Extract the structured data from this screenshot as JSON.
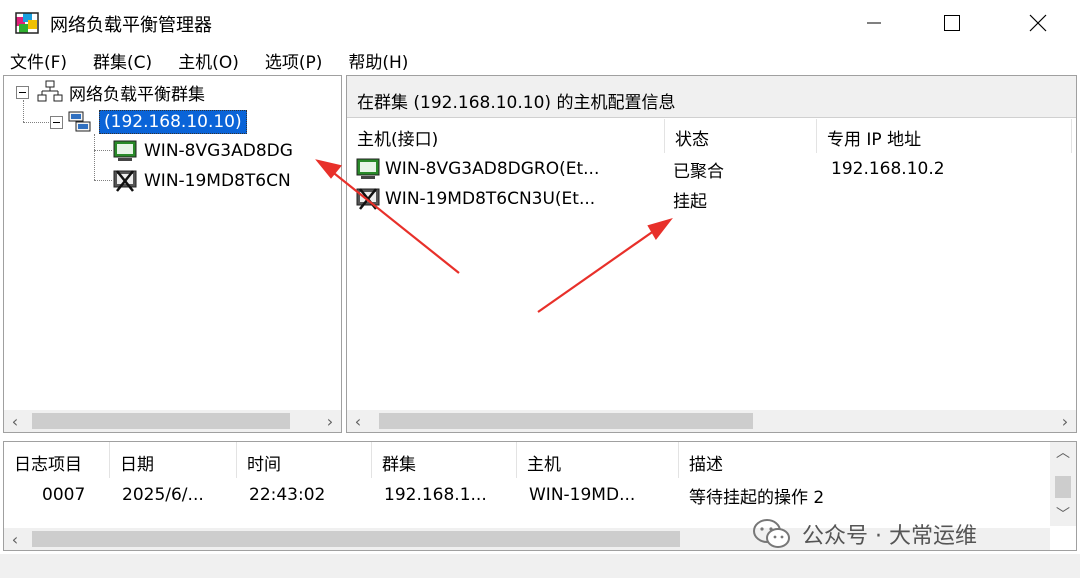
{
  "window": {
    "title": "网络负载平衡管理器"
  },
  "menu": [
    "文件(F)",
    "群集(C)",
    "主机(O)",
    "选项(P)",
    "帮助(H)"
  ],
  "tree": {
    "root_label": "网络负载平衡群集",
    "cluster_label": "(192.168.10.10)",
    "hosts": [
      "WIN-8VG3AD8DG",
      "WIN-19MD8T6CN"
    ]
  },
  "detail": {
    "caption": "在群集 (192.168.10.10) 的主机配置信息",
    "columns": [
      "主机(接口)",
      "状态",
      "专用 IP 地址"
    ],
    "rows": [
      {
        "host": "WIN-8VG3AD8DGRO(Et...",
        "status": "已聚合",
        "ip": "192.168.10.2",
        "icon": "host-converged-icon"
      },
      {
        "host": "WIN-19MD8T6CN3U(Et...",
        "status": "挂起",
        "ip": "",
        "icon": "host-suspended-icon"
      }
    ]
  },
  "log": {
    "columns": [
      "日志项目",
      "日期",
      "时间",
      "群集",
      "主机",
      "描述"
    ],
    "rows": [
      {
        "item": "0007",
        "date": "2025/6/...",
        "time": "22:43:02",
        "cluster": "192.168.1...",
        "host": "WIN-19MD...",
        "desc": "等待挂起的操作 2"
      }
    ]
  },
  "watermark": {
    "text": "公众号 · 大常运维"
  },
  "colors": {
    "selection": "#0a64d8",
    "annotation_arrow": "#e8302a"
  }
}
